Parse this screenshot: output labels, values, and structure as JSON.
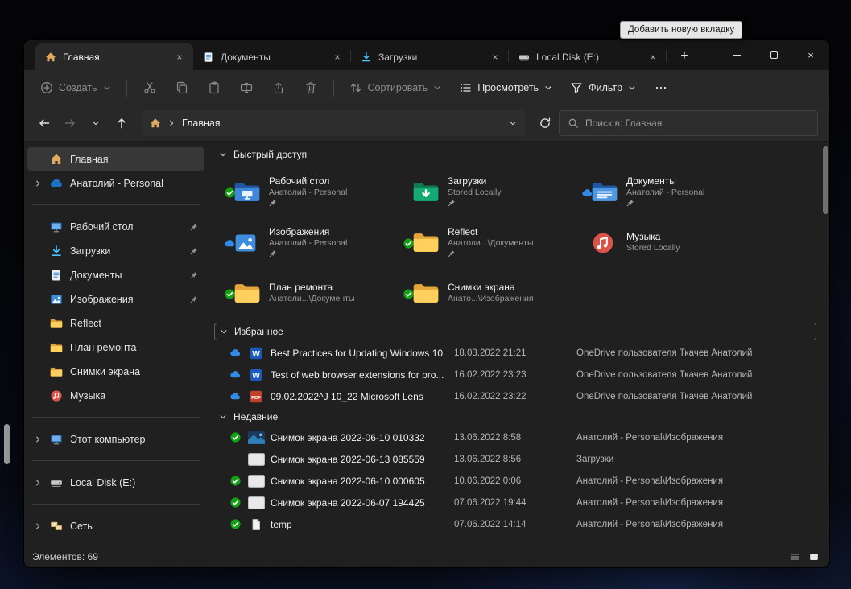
{
  "tooltip": {
    "text": "Добавить новую вкладку"
  },
  "colors": {
    "accent_blue": "#4cc2ff",
    "folder_yellow": "#ffd05e",
    "sync_green": "#14a014",
    "cloud_blue": "#2f8be6",
    "word_blue": "#185abd",
    "pdf_red": "#c43e2e"
  },
  "icons": {
    "tab_home": "home-icon",
    "tab_documents": "document-icon",
    "tab_downloads": "download-icon",
    "tab_disk": "disk-icon",
    "search": "magnifier",
    "sync_ok": "green-check-circle",
    "cloud_status": "blue-cloud",
    "pinned": "pin"
  },
  "window": {
    "tabs": [
      {
        "label": "Главная"
      },
      {
        "label": "Документы"
      },
      {
        "label": "Загрузки"
      },
      {
        "label": "Local Disk (E:)"
      }
    ]
  },
  "toolbar": {
    "create_label": "Создать",
    "sort_label": "Сортировать",
    "view_label": "Просмотреть",
    "filter_label": "Фильтр"
  },
  "addressbar": {
    "breadcrumb_root": "Главная",
    "search_placeholder": "Поиск в: Главная"
  },
  "sidebar": {
    "items": [
      {
        "label": "Главная"
      },
      {
        "label": "Анатолий - Personal"
      },
      {
        "label": "Рабочий стол"
      },
      {
        "label": "Загрузки"
      },
      {
        "label": "Документы"
      },
      {
        "label": "Изображения"
      },
      {
        "label": "Reflect"
      },
      {
        "label": "План ремонта"
      },
      {
        "label": "Снимки экрана"
      },
      {
        "label": "Музыка"
      },
      {
        "label": "Этот компьютер"
      },
      {
        "label": "Local Disk (E:)"
      },
      {
        "label": "Сеть"
      }
    ]
  },
  "quick_access": {
    "title": "Быстрый доступ",
    "tiles": [
      {
        "name": "Рабочий стол",
        "subtitle": "Анатолий - Personal"
      },
      {
        "name": "Загрузки",
        "subtitle": "Stored Locally"
      },
      {
        "name": "Документы",
        "subtitle": "Анатолий - Personal"
      },
      {
        "name": "Изображения",
        "subtitle": "Анатолий - Personal"
      },
      {
        "name": "Reflect",
        "subtitle": "Анатоли...\\Документы"
      },
      {
        "name": "Музыка",
        "subtitle": "Stored Locally"
      },
      {
        "name": "План ремонта",
        "subtitle": "Анатоли...\\Документы"
      },
      {
        "name": "Снимки экрана",
        "subtitle": "Анато...\\Изображения"
      }
    ]
  },
  "favorites": {
    "title": "Избранное",
    "rows": [
      {
        "name": "Best Practices for Updating Windows 10",
        "date": "18.03.2022 21:21",
        "location": "OneDrive пользователя Ткачев Анатолий"
      },
      {
        "name": "Test of web browser extensions for pro...",
        "date": "16.02.2022 23:23",
        "location": "OneDrive пользователя Ткачев Анатолий"
      },
      {
        "name": "09.02.2022^J 10_22 Microsoft Lens",
        "date": "16.02.2022 23:22",
        "location": "OneDrive пользователя Ткачев Анатолий"
      }
    ]
  },
  "recent": {
    "title": "Недавние",
    "rows": [
      {
        "name": "Снимок экрана 2022-06-10 010332",
        "date": "13.06.2022 8:58",
        "location": "Анатолий - Personal\\Изображения"
      },
      {
        "name": "Снимок экрана 2022-06-13 085559",
        "date": "13.06.2022 8:56",
        "location": "Загрузки"
      },
      {
        "name": "Снимок экрана 2022-06-10 000605",
        "date": "10.06.2022 0:06",
        "location": "Анатолий - Personal\\Изображения"
      },
      {
        "name": "Снимок экрана 2022-06-07 194425",
        "date": "07.06.2022 19:44",
        "location": "Анатолий - Personal\\Изображения"
      },
      {
        "name": "temp",
        "date": "07.06.2022 14:14",
        "location": "Анатолий - Personal\\Изображения"
      }
    ]
  },
  "statusbar": {
    "items_count": "Элементов: 69"
  }
}
